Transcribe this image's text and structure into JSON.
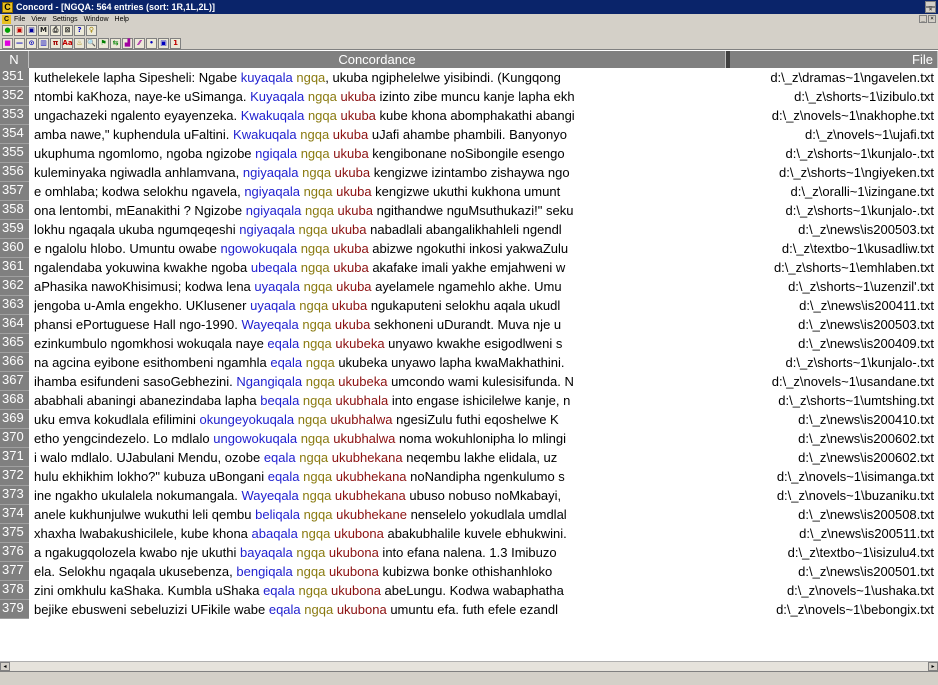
{
  "window": {
    "app_icon": "C",
    "title": "Concord - [NGQA: 564 entries (sort: 1R,1L,2L)]",
    "min_label": "_",
    "close_label": "×"
  },
  "menu": {
    "app_icon": "C",
    "items": [
      "File",
      "View",
      "Settings",
      "Window",
      "Help"
    ],
    "mdi_min": "_",
    "mdi_close": "×"
  },
  "toolbar1": [
    {
      "name": "stop-icon",
      "glyph": "●",
      "color": "#00a000"
    },
    {
      "name": "save-icon",
      "glyph": "▣",
      "color": "#c00000"
    },
    {
      "name": "disk-icon",
      "glyph": "▣",
      "color": "#0000a0"
    },
    {
      "name": "mail-icon",
      "glyph": "M",
      "color": "#202020"
    },
    {
      "name": "print-icon",
      "glyph": "⎙",
      "color": "#202020"
    },
    {
      "name": "preview-icon",
      "glyph": "⊠",
      "color": "#202020"
    },
    {
      "name": "help-icon",
      "glyph": "?",
      "color": "#0000c0"
    },
    {
      "name": "tip-icon",
      "glyph": "♀",
      "color": "#a08000"
    }
  ],
  "toolbar2": [
    {
      "name": "color-icon",
      "glyph": "■",
      "color": "#e000e0"
    },
    {
      "name": "line-icon",
      "glyph": "—",
      "color": "#0000c0"
    },
    {
      "name": "target-icon",
      "glyph": "⊙",
      "color": "#0000c0"
    },
    {
      "name": "columns-icon",
      "glyph": "▥",
      "color": "#0000c0"
    },
    {
      "name": "pi-icon",
      "glyph": "π",
      "color": "#a00000"
    },
    {
      "name": "aa-icon",
      "glyph": "Aa",
      "color": "#c00000"
    },
    {
      "name": "sort-icon",
      "glyph": "♨",
      "color": "#a08000"
    },
    {
      "name": "search-icon",
      "glyph": "🔍",
      "color": "#202020"
    },
    {
      "name": "flag-icon",
      "glyph": "⚑",
      "color": "#008000"
    },
    {
      "name": "arrows-icon",
      "glyph": "⇆",
      "color": "#008000"
    },
    {
      "name": "chart-icon",
      "glyph": "▟",
      "color": "#a000a0"
    },
    {
      "name": "plot-icon",
      "glyph": "⁄⁄",
      "color": "#a000a0"
    },
    {
      "name": "dot-icon",
      "glyph": "•",
      "color": "#0000c0"
    },
    {
      "name": "box-icon",
      "glyph": "▣",
      "color": "#0000c0"
    },
    {
      "name": "one-icon",
      "glyph": "1",
      "color": "#c00000"
    }
  ],
  "columns": {
    "n": "N",
    "concordance": "Concordance",
    "file": "File"
  },
  "rows": [
    {
      "n": "351",
      "pre": "kuthelekele lapha  Sipesheli: Ngabe ",
      "k1": "kuyaqala",
      "k2": " ngqa",
      "k3": "",
      "post": ", ukuba ngiphelelwe yisibindi. (Kungqong",
      "file": "d:\\_z\\dramas~1\\ngavelen.txt"
    },
    {
      "n": "352",
      "pre": "ntombi kaKhoza, naye-ke uSimanga. ",
      "k1": "Kuyaqala",
      "k2": " ngqa",
      "k3": " ukuba",
      "post": " izinto zibe muncu kanje lapha ekh",
      "file": "d:\\_z\\shorts~1\\izibulo.txt"
    },
    {
      "n": "353",
      "pre": "ungachazeki ngalento eyayenzeka. ",
      "k1": "Kwakuqala",
      "k2": " ngqa",
      "k3": " ukuba",
      "post": " kube khona abomphakathi abangi",
      "file": "d:\\_z\\novels~1\\nakhophe.txt"
    },
    {
      "n": "354",
      "pre": "amba nawe,\" kuphendula uFaltini.  ",
      "k1": "Kwakuqala",
      "k2": " ngqa",
      "k3": " ukuba",
      "post": " uJafi ahambe phambili. Banyonyo",
      "file": "d:\\_z\\novels~1\\ujafi.txt"
    },
    {
      "n": "355",
      "pre": " ukuphuma ngomlomo, ngoba ngizobe ",
      "k1": "ngiqala",
      "k2": " ngqa",
      "k3": " ukuba",
      "post": " kengibonane noSibongile esengo",
      "file": "d:\\_z\\shorts~1\\kunjalo-.txt"
    },
    {
      "n": "356",
      "pre": "kuleminyaka  ngiwadla anhlamvana, ",
      "k1": "ngiyaqala",
      "k2": " ngqa",
      "k3": " ukuba",
      "post": " kengizwe izintambo zishaywa ngo",
      "file": "d:\\_z\\shorts~1\\ngiyeken.txt"
    },
    {
      "n": "357",
      "pre": "e omhlaba; kodwa selokhu ngavela, ",
      "k1": "ngiyaqala",
      "k2": " ngqa",
      "k3": " ukuba",
      "post": " kengizwe  ukuthi kukhona umunt",
      "file": "d:\\_z\\oralli~1\\izingane.txt"
    },
    {
      "n": "358",
      "pre": "ona lentombi, mEanakithi ? Ngizobe ",
      "k1": "ngiyaqala",
      "k2": " ngqa",
      "k3": " ukuba",
      "post": " ngithandwe nguMsuthukazi!\" seku",
      "file": "d:\\_z\\shorts~1\\kunjalo-.txt"
    },
    {
      "n": "359",
      "pre": " lokhu ngaqala ukuba ngumqeqeshi ",
      "k1": "ngiyaqala",
      "k2": " ngqa",
      "k3": " ukuba",
      "post": " nabadlali  abangalikhahleli ngendl",
      "file": "d:\\_z\\news\\is200503.txt"
    },
    {
      "n": "360",
      "pre": "e ngalolu hlobo. Umuntu  owabe ",
      "k1": "ngowokuqala",
      "k2": " ngqa",
      "k3": " ukuba",
      "post": " abizwe ngokuthi inkosi yakwaZulu",
      "file": "d:\\_z\\textbo~1\\kusadliw.txt"
    },
    {
      "n": "361",
      "pre": " ngalendaba  yokuwina kwakhe ngoba ",
      "k1": "ubeqala",
      "k2": " ngqa",
      "k3": " ukuba",
      "post": " akafake imali yakhe  emjahweni w",
      "file": "d:\\_z\\shorts~1\\emhlaben.txt"
    },
    {
      "n": "362",
      "pre": " aPhasika nawoKhisimusi; kodwa lena ",
      "k1": "uyaqala",
      "k2": " ngqa",
      "k3": " ukuba",
      "post": " ayelamele  ngamehlo akhe. Umu",
      "file": "d:\\_z\\shorts~1\\uzenzil'.txt"
    },
    {
      "n": "363",
      "pre": "jengoba u-Amla  engekho.  UKlusener ",
      "k1": "uyaqala",
      "k2": " ngqa",
      "k3": " ukuba",
      "post": " ngukaputeni selokhu aqala ukudl",
      "file": "d:\\_z\\news\\is200411.txt"
    },
    {
      "n": "364",
      "pre": " phansi ePortuguese Hall ngo-1990. ",
      "k1": "Wayeqala",
      "k2": " ngqa",
      "k3": " ukuba",
      "post": "  sekhoneni uDurandt.  Muva nje u",
      "file": "d:\\_z\\news\\is200503.txt"
    },
    {
      "n": "365",
      "pre": "ezinkumbulo  ngomkhosi wokuqala naye ",
      "k1": "eqala",
      "k2": " ngqa",
      "k3": " ukubeka",
      "post": " unyawo kwakhe esigodlweni  s",
      "file": "d:\\_z\\news\\is200409.txt"
    },
    {
      "n": "366",
      "pre": "na agcina eyibone esithombeni ngamhla ",
      "k1": "eqala",
      "k2": " ngqa",
      "k3": "",
      "post": "  ukubeka unyawo lapha kwaMakhathini.",
      "file": "d:\\_z\\shorts~1\\kunjalo-.txt"
    },
    {
      "n": "367",
      "pre": "ihamba esifundeni sasoGebhezini. ",
      "k1": "Ngangiqala",
      "k2": " ngqa",
      "k3": " ukubeka",
      "post": " umcondo wami kulesisifunda. N",
      "file": "d:\\_z\\novels~1\\usandane.txt"
    },
    {
      "n": "368",
      "pre": "ababhali abaningi abanezindaba lapha ",
      "k1": "beqala",
      "k2": " ngqa",
      "k3": " ukubhala",
      "post": " into engase ishicilelwe kanje, n",
      "file": "d:\\_z\\shorts~1\\umtshing.txt"
    },
    {
      "n": "369",
      "pre": " uku emva kokudlala  efilimini ",
      "k1": "okungeyokuqala",
      "k2": " ngqa",
      "k3": " ukubhalwa",
      "post": " ngesiZulu futhi eqoshelwe  K",
      "file": "d:\\_z\\news\\is200410.txt"
    },
    {
      "n": "370",
      "pre": "etho yengcindezelo.  Lo mdlalo ",
      "k1": "ungowokuqala",
      "k2": " ngqa",
      "k3": " ukubhalwa",
      "post": " noma wokuhlonipha lo mlingi",
      "file": "d:\\_z\\news\\is200602.txt"
    },
    {
      "n": "371",
      "pre": " i walo mdlalo.  UJabulani Mendu, ozobe ",
      "k1": "eqala",
      "k2": " ngqa",
      "k3": " ukubhekana",
      "post": " neqembu lakhe elidala,  uz",
      "file": "d:\\_z\\news\\is200602.txt"
    },
    {
      "n": "372",
      "pre": "hulu ekhikhim lokho?\" kubuza uBongani ",
      "k1": "eqala",
      "k2": " ngqa",
      "k3": " ukubhekana",
      "post": " noNandipha  ngenkulumo s",
      "file": "d:\\_z\\novels~1\\isimanga.txt"
    },
    {
      "n": "373",
      "pre": "ine ngakho ukulalela nokumangala. ",
      "k1": "Wayeqala",
      "k2": " ngqa",
      "k3": " ukubhekana",
      "post": " ubuso nobuso noMkabayi,",
      "file": "d:\\_z\\novels~1\\buzaniku.txt"
    },
    {
      "n": "374",
      "pre": "anele kukhunjulwe wukuthi leli qembu ",
      "k1": "beliqala",
      "k2": " ngqa",
      "k3": " ukubhekane",
      "post": "  nenselelo yokudlala umdlal",
      "file": "d:\\_z\\news\\is200508.txt"
    },
    {
      "n": "375",
      "pre": " xhaxha  lwabakushicilele, kube khona ",
      "k1": "abaqala",
      "k2": " ngqa",
      "k3": " ukubona",
      "post": " abakubhalile kuvele  ebhukwini.",
      "file": "d:\\_z\\news\\is200511.txt"
    },
    {
      "n": "376",
      "pre": " a ngakugqolozela kwabo nje ukuthi  ",
      "k1": "bayaqala",
      "k2": " ngqa",
      "k3": " ukubona",
      "post": " into efana nalena.  1.3 Imibuzo",
      "file": "d:\\_z\\textbo~1\\isizulu4.txt"
    },
    {
      "n": "377",
      "pre": "ela.  Selokhu ngaqala ukusebenza, ",
      "k1": "bengiqala",
      "k2": " ngqa",
      "k3": " ukubona",
      "post": " kubizwa bonke  othishanhloko",
      "file": "d:\\_z\\news\\is200501.txt"
    },
    {
      "n": "378",
      "pre": " zini omkhulu kaShaka.  Kumbla uShaka ",
      "k1": "eqala",
      "k2": " ngqa",
      "k3": " ukubona",
      "post": " abeLungu.  Kodwa  wabaphatha",
      "file": "d:\\_z\\novels~1\\ushaka.txt"
    },
    {
      "n": "379",
      "pre": "bejike ebusweni  sebeluzizi UFikile wabe ",
      "k1": "eqala",
      "k2": " ngqa",
      "k3": " ukubona",
      "post": " umuntu efa.  futh   efele ezandl",
      "file": "d:\\_z\\novels~1\\bebongix.txt"
    }
  ],
  "scroll": {
    "left": "◂",
    "right": "▸"
  }
}
